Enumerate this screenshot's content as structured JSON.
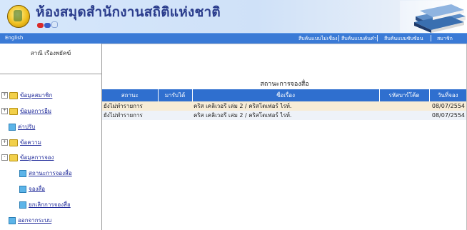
{
  "header": {
    "site_title": "ห้องสมุดสำนักงานสถิติแห่งชาติ",
    "colors": {
      "banner": "#cfe1f8",
      "title": "#2a3c8c",
      "navbar": "#3a7ad6",
      "table_header": "#2f6fcf",
      "link": "#1f2a9a"
    }
  },
  "navbar": {
    "english": "English",
    "menu": [
      "สืบค้นแบบไม่เชื่อง",
      "สืบค้นแบบค้นคำ",
      "สืบค้นแบบซับซ้อน",
      "สมาชิก"
    ]
  },
  "sidebar": {
    "header": "สาณี เรืองพยัคฆ์",
    "items": [
      {
        "label": "ข้อมูลสมาชิก",
        "icon": "folder-icon",
        "toggle": "+"
      },
      {
        "label": "ข้อมูลการยืม",
        "icon": "folder-icon",
        "toggle": "+"
      },
      {
        "label": "ค่าปรับ",
        "icon": "page-icon"
      },
      {
        "label": "ข้อความ",
        "icon": "folder-icon",
        "toggle": "+"
      },
      {
        "label": "ข้อมูลการจอง",
        "icon": "folder-icon",
        "toggle": "-"
      },
      {
        "label": "สถานะการจองสื่อ",
        "icon": "page-icon"
      },
      {
        "label": "จองสื่อ",
        "icon": "page-icon"
      },
      {
        "label": "ยกเลิกการจองสื่อ",
        "icon": "page-icon"
      },
      {
        "label": "ออกจากระบบ",
        "icon": "page-icon"
      }
    ]
  },
  "main": {
    "title": "สถานะการจองสื่อ",
    "columns": [
      "สถานะ",
      "มารับได้",
      "ชื่อเรื่อง",
      "รหัสบาร์โค้ด",
      "วันที่จอง"
    ],
    "rows": [
      {
        "status": "ยังไม่ทำรายการ",
        "pickup": "",
        "title": "คริส เคลิเวอรี เล่ม 2 / คริสโตเฟอร์ ไรท์.",
        "barcode": "",
        "date": "08/07/2554"
      },
      {
        "status": "ยังไม่ทำรายการ",
        "pickup": "",
        "title": "คริส เคลิเวอรี เล่ม 2 / คริสโตเฟอร์ ไรท์.",
        "barcode": "",
        "date": "08/07/2554"
      }
    ]
  }
}
